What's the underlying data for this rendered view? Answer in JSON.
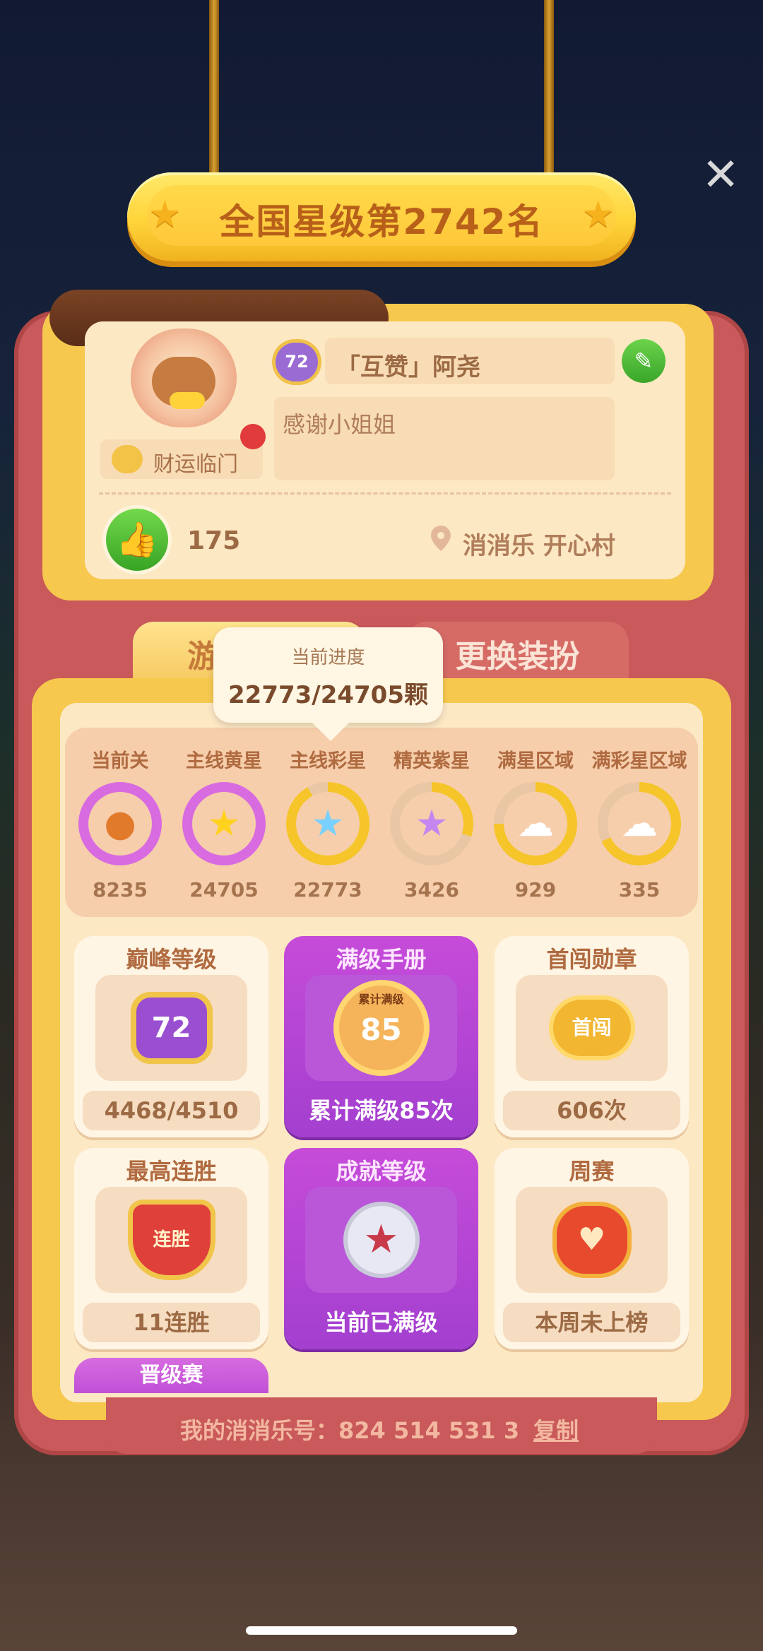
{
  "banner": {
    "rank_text": "全国星级第2742名"
  },
  "profile": {
    "level": "72",
    "name": "「互赞」阿尧",
    "signature": "感谢小姐姐",
    "title": "财运临门",
    "likes": "175",
    "location": "消消乐  开心村"
  },
  "tabs": {
    "records": "游戏记录",
    "outfit": "更换装扮"
  },
  "tooltip": {
    "label": "当前进度",
    "value": "22773/24705颗"
  },
  "stats": [
    {
      "label": "当前关",
      "value": "8235",
      "icon": "persimmon-icon"
    },
    {
      "label": "主线黄星",
      "value": "24705",
      "icon": "yellow-star-icon"
    },
    {
      "label": "主线彩星",
      "value": "22773",
      "icon": "rainbow-star-icon"
    },
    {
      "label": "精英紫星",
      "value": "3426",
      "icon": "purple-star-icon"
    },
    {
      "label": "满星区域",
      "value": "929",
      "icon": "cloud-icon"
    },
    {
      "label": "满彩星区域",
      "value": "335",
      "icon": "rainbow-cloud-icon"
    }
  ],
  "cards": {
    "peak": {
      "title": "巅峰等级",
      "badge": "72",
      "footer": "4468/4510"
    },
    "manual": {
      "title": "满级手册",
      "badge": "85",
      "badge_caption": "累计满级",
      "footer": "累计满级85次"
    },
    "first": {
      "title": "首闯勋章",
      "badge": "首闯",
      "footer": "606次"
    },
    "streak": {
      "title": "最高连胜",
      "badge": "连胜",
      "footer": "11连胜"
    },
    "achieve": {
      "title": "成就等级",
      "footer": "当前已满级"
    },
    "weekly": {
      "title": "周赛",
      "footer": "本周未上榜"
    }
  },
  "promo": "晋级赛",
  "footer": {
    "id_label": "我的消消乐号：824 514 531 3",
    "copy": "复制"
  },
  "colors": {
    "accent_purple": "#a33fcf",
    "card_bg": "#fde8c4",
    "frame": "#c9595a"
  }
}
